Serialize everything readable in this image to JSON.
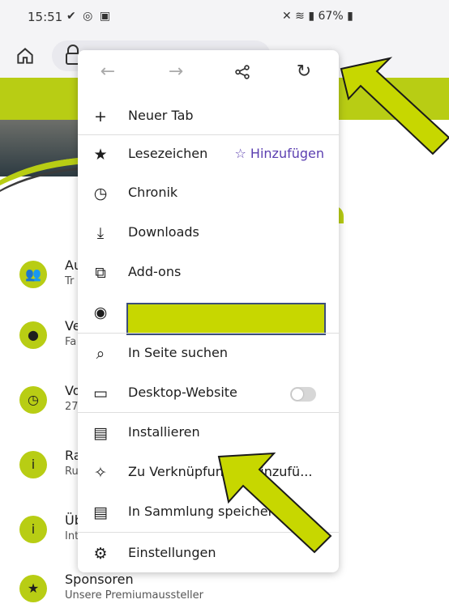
{
  "status_bar": {
    "time": "15:51",
    "battery": "67%"
  },
  "menu": {
    "new_tab": "Neuer Tab",
    "bookmarks": "Lesezeichen",
    "bookmarks_action": "☆ Hinzufügen",
    "history": "Chronik",
    "downloads": "Downloads",
    "addons": "Add-ons",
    "find_in_page": "In Seite suchen",
    "desktop_site": "Desktop-Website",
    "install": "Installieren",
    "add_shortcut": "Zu Verknüpfungen hinzufü...",
    "save_collection": "In Sammlung speichern",
    "settings": "Einstellungen"
  },
  "page": {
    "items": [
      {
        "title": "Au",
        "sub": "Tr"
      },
      {
        "title": "Ve",
        "sub": "Fa"
      },
      {
        "title": "Vo",
        "sub": "27"
      },
      {
        "title": "Ra",
        "sub": "Ru"
      },
      {
        "title": "Üb",
        "sub": "Int"
      },
      {
        "title": "Sponsoren",
        "sub": "Unsere Premiumaussteller"
      }
    ]
  },
  "colors": {
    "accent": "#b8cd14",
    "arrow": "#c7d700",
    "link": "#5b3fb0"
  },
  "icons": [
    "home-icon",
    "lock-icon",
    "back-icon",
    "forward-icon",
    "share-icon",
    "reload-icon",
    "plus-icon",
    "bookmark-icon",
    "clock-icon",
    "download-icon",
    "puzzle-icon",
    "account-icon",
    "search-icon",
    "laptop-icon",
    "install-icon",
    "shortcut-icon",
    "collection-icon",
    "gear-icon"
  ]
}
